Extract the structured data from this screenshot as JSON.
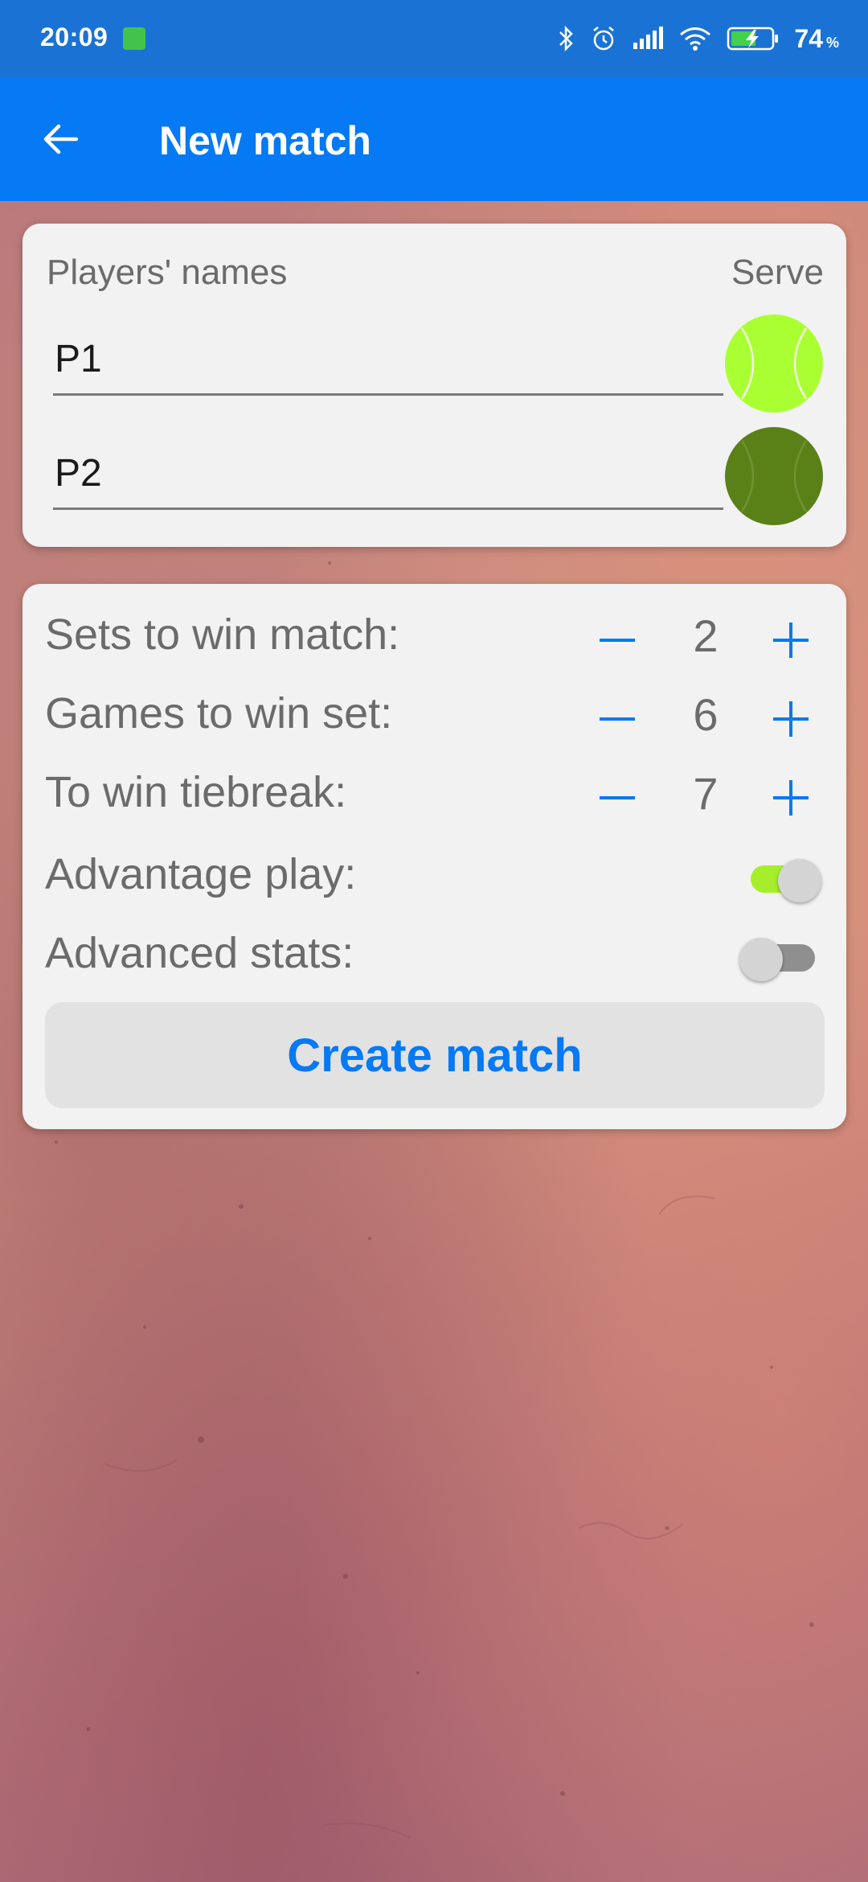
{
  "status_bar": {
    "time": "20:09",
    "battery_percent": "74",
    "battery_unit": "%",
    "icons": [
      "app-notification-icon",
      "bluetooth-icon",
      "alarm-icon",
      "signal-icon",
      "wifi-icon",
      "battery-charging-icon"
    ]
  },
  "app_bar": {
    "title": "New match",
    "back_icon": "arrow-left-icon"
  },
  "players": {
    "header_label": "Players' names",
    "serve_label": "Serve",
    "player1_name": "P1",
    "player2_name": "P2",
    "serve_ball_colors": [
      "#aaff33",
      "#5a8018"
    ]
  },
  "settings": {
    "sets_to_win_label": "Sets to win match:",
    "sets_to_win_value": "2",
    "games_to_win_label": "Games to win set:",
    "games_to_win_value": "6",
    "tiebreak_label": "To win tiebreak:",
    "tiebreak_value": "7",
    "advantage_label": "Advantage play:",
    "advantage_on": true,
    "advanced_stats_label": "Advanced stats:",
    "advanced_stats_on": false,
    "decrement_symbol": "−",
    "increment_symbol": "+"
  },
  "create_button_label": "Create match",
  "colors": {
    "status_bar": "#1a73d4",
    "app_bar": "#0679f4",
    "accent": "#0679f4",
    "toggle_on": "#a6ee2c"
  }
}
